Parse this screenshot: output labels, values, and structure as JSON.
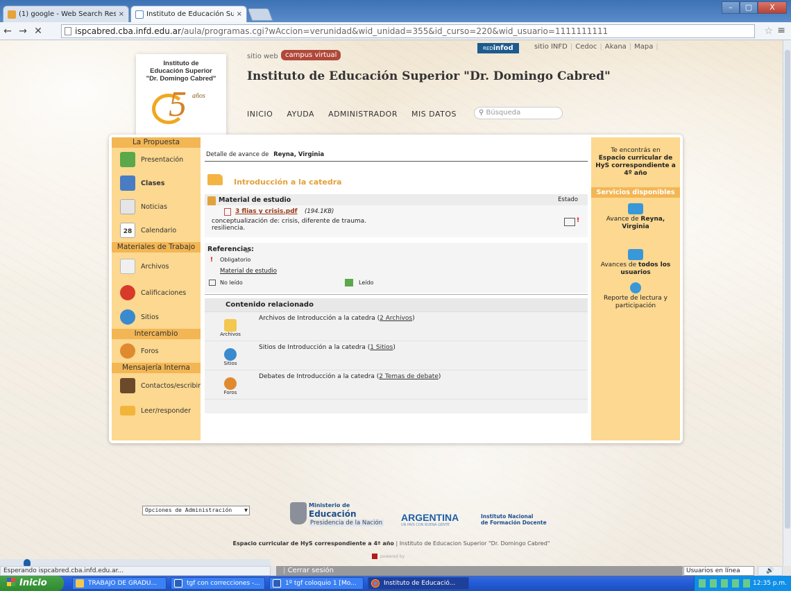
{
  "browser": {
    "tabs": [
      {
        "label": "(1) google - Web Search Res",
        "close": "×"
      },
      {
        "label": "Instituto de Educación Super",
        "close": "×"
      }
    ],
    "url_host": "ispcabred.cba.infd.edu.ar",
    "url_path": "/aula/programas.cgi?wAccion=verunidad&wid_unidad=355&id_curso=220&wid_usuario=1111111111",
    "nav_back": "←",
    "nav_forward": "→",
    "nav_stop": "✕",
    "star": "☆",
    "menu": "≡",
    "window_buttons": {
      "min": "–",
      "max": "▢",
      "close": "X"
    }
  },
  "header": {
    "logo_text": [
      "Instituto de",
      "Educación Superior",
      "\"Dr. Domingo Cabred\""
    ],
    "logo_number": "5",
    "logo_anos": "años",
    "sitio_web": "sitio web",
    "campus_virtual": "campus virtual",
    "title": "Instituto de Educación Superior \"Dr. Domingo Cabred\"",
    "redinfod_prefix": "RED",
    "redinfod_brand": "infod",
    "top_links": [
      "sitio INFD",
      "Cedoc",
      "Akana",
      "Mapa"
    ],
    "nav": [
      "INICIO",
      "AYUDA",
      "ADMINISTRADOR",
      "MIS DATOS"
    ],
    "search_placeholder": "Búsqueda"
  },
  "left_sidebar": {
    "sections": {
      "propuesta": "La Propuesta",
      "materiales": "Materiales de Trabajo",
      "intercambio": "Intercambio",
      "mensajeria": "Mensajería Interna"
    },
    "items": {
      "presentacion": "Presentación",
      "clases": "Clases",
      "noticias": "Noticias",
      "calendario": "Calendario",
      "calendario_day": "28",
      "archivos": "Archivos",
      "calificaciones": "Calificaciones",
      "sitios": "Sitios",
      "foros": "Foros",
      "contactos": "Contactos/escribir",
      "leer": "Leer/responder"
    }
  },
  "main": {
    "detalle_prefix": "Detalle de avance de",
    "detalle_user": "Reyna, Virginia",
    "intro_title": "Introducción a la catedra",
    "material_header": "Material de estudio",
    "estado_header": "Estado",
    "file_name": "3 flias y crisis.pdf",
    "file_size": "(194.1KB)",
    "file_desc_1": "conceptualización de: crisis, diferente de trauma.",
    "file_desc_2": "resiliencia.",
    "referencias_title": "Referencias:",
    "ref_obligatorio": "Obligatorio",
    "ref_material": "Material de estudio",
    "ref_no_leido": "No leído",
    "ref_leido": "Leído",
    "related_title": "Contenido relacionado",
    "related_items": [
      {
        "icon_label": "Archivos",
        "text": "Archivos de Introducción a la catedra (",
        "link": "2 Archivos",
        "suffix": ")"
      },
      {
        "icon_label": "Sitios",
        "text": "Sitios de Introducción a la catedra (",
        "link": "1 Sitios",
        "suffix": ")"
      },
      {
        "icon_label": "Foros",
        "text": "Debates de Introducción a la catedra (",
        "link": "2 Temas de debate",
        "suffix": ")"
      }
    ]
  },
  "right_sidebar": {
    "intro_1": "Te encontrás en",
    "intro_2": "Espacio curricular de HyS correspondiente a 4º año",
    "servicios_title": "Servicios disponibles",
    "avance_prefix": "Avance de",
    "avance_user": "Reyna, Virginia",
    "avances_prefix": "Avances de",
    "avances_bold": "todos los usuarios",
    "reporte": "Reporte de lectura y participación"
  },
  "footer": {
    "admin_select_value": "Opciones de Administración",
    "ministerio_1": "Ministerio de",
    "ministerio_2": "Educación",
    "ministerio_3": "Presidencia de la Nación",
    "argentina": "ARGENTINA",
    "argentina_sub": "UN PAÍS CON BUENA GENTE",
    "infd_1": "Instituto Nacional",
    "infd_2": "de Formación Docente",
    "footer_bold": "Espacio curricular de HyS correspondiente a 4º año",
    "footer_rest": " | Instituto de Educacion Superior \"Dr. Domingo Cabred\"",
    "powered": "powered by"
  },
  "status": {
    "loading": "Esperando ispcabred.cba.infd.edu.ar...",
    "cerrar_sesion": "Cerrar sesión",
    "usuarios": "Usuarios en línea",
    "speaker": "🔊"
  },
  "taskbar": {
    "start": "Inicio",
    "tasks": [
      "TRABAJO DE GRADU...",
      "tgf con correcciones -...",
      "1º tgf coloquio 1 [Mo...",
      "Instituto de Educació..."
    ],
    "clock": "12:35 p.m."
  },
  "colors": {
    "sidebar_bg": "#fcd890",
    "section_head": "#f3b654",
    "intro_title": "#e3a13a",
    "campus_badge": "#b0483a"
  }
}
